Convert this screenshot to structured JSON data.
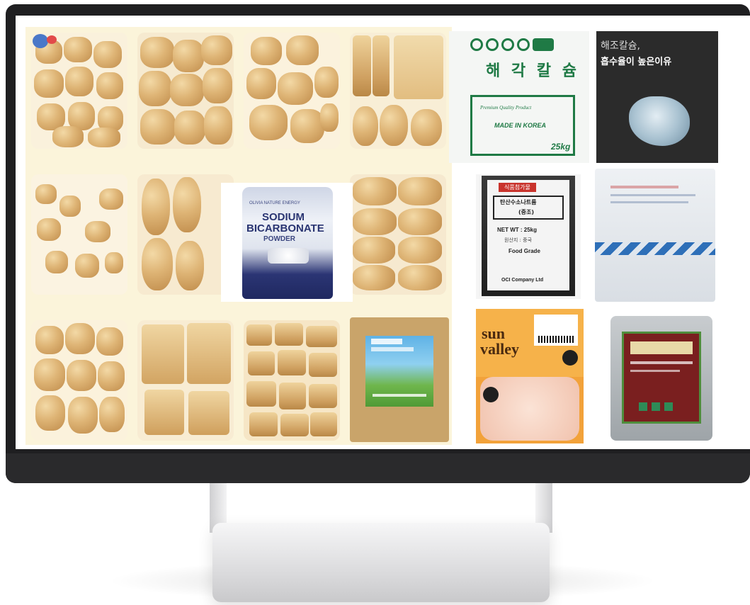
{
  "calcium": {
    "title": "해 각 칼 슘",
    "label1": "Premium Quality Product",
    "label2": "MADE IN KOREA",
    "weight": "25kg"
  },
  "seaweed": {
    "line1": "해조칼슘,",
    "line2": "흡수율이 높은이유"
  },
  "bicarb": {
    "brand": "OLIVIA NATURE ENERGY",
    "line1": "SODIUM",
    "line2": "BICARBONATE",
    "line3": "POWDER"
  },
  "oci": {
    "header": "식품첨가물",
    "name": "탄산수소나트륨",
    "sub": "(중조)",
    "net": "NET WT : 25kg",
    "origin": "원산지 : 중국",
    "grade": "Food Grade",
    "company": "OCI Company Ltd"
  },
  "sunvalley": {
    "brand1": "sun",
    "brand2": "valley"
  },
  "colors": {
    "panel_bg": "#fbf4da",
    "calcium_green": "#1f7a45",
    "bicarb_navy": "#25306e",
    "sunvalley_orange": "#f2a23a",
    "kappa_red": "#7a1f1f",
    "bag_stripe_blue": "#2e6fb8"
  }
}
